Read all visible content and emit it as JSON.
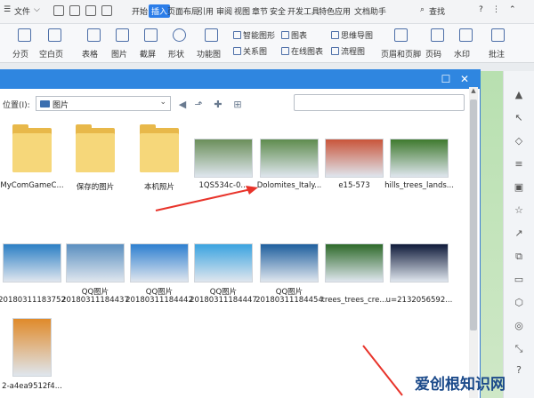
{
  "menubar": {
    "items": [
      "文件",
      "开始",
      "插入",
      "页面布局",
      "引用",
      "审阅",
      "视图",
      "章节",
      "安全",
      "开发工具",
      "特色应用",
      "文档助手"
    ],
    "search_label": "查找",
    "active": "插入"
  },
  "ribbon": {
    "buttons": [
      "分页",
      "空白页",
      "表格",
      "图片",
      "截屏",
      "形状",
      "功能图",
      "智能图形",
      "关系图",
      "图表",
      "在线图表",
      "思维导图",
      "流程图",
      "页眉和页脚",
      "页码",
      "水印",
      "批注"
    ]
  },
  "dialog": {
    "location_label": "位置(I):",
    "location_value": "图片"
  },
  "files": [
    {
      "name": "MyComGameC...",
      "kind": "folder"
    },
    {
      "name": "保存的图片",
      "kind": "folder"
    },
    {
      "name": "本机照片",
      "kind": "folder"
    },
    {
      "name": "1QS534c-0...",
      "kind": "image",
      "color": "#6b8f5a"
    },
    {
      "name": "Dolomites_Italy...",
      "kind": "image",
      "color": "#5f8c4e"
    },
    {
      "name": "e15-573",
      "kind": "image",
      "color": "#c9553a"
    },
    {
      "name": "hills_trees_lands...",
      "kind": "image",
      "color": "#3f7a2e"
    },
    {
      "name": "20180311183752",
      "kind": "image",
      "color": "#2b7fc4"
    },
    {
      "name": "20180311184437",
      "kind": "image",
      "color": "#5a8fc0"
    },
    {
      "name": "20180311184442",
      "kind": "image",
      "color": "#2d7fd0"
    },
    {
      "name": "20180311184447",
      "kind": "image",
      "color": "#3aa3e0"
    },
    {
      "name": "20180311184454",
      "kind": "image",
      "color": "#1e5f9e"
    },
    {
      "name": "trees_trees_cre...",
      "kind": "image",
      "color": "#2e6a2a"
    },
    {
      "name": "u=2132056592...",
      "kind": "image",
      "color": "#0f1a3a"
    },
    {
      "name": "2-a4ea9512f4...",
      "kind": "image",
      "color": "#e08a2a"
    }
  ],
  "qq_label": "QQ图片",
  "watermark": "爱创根知识网"
}
